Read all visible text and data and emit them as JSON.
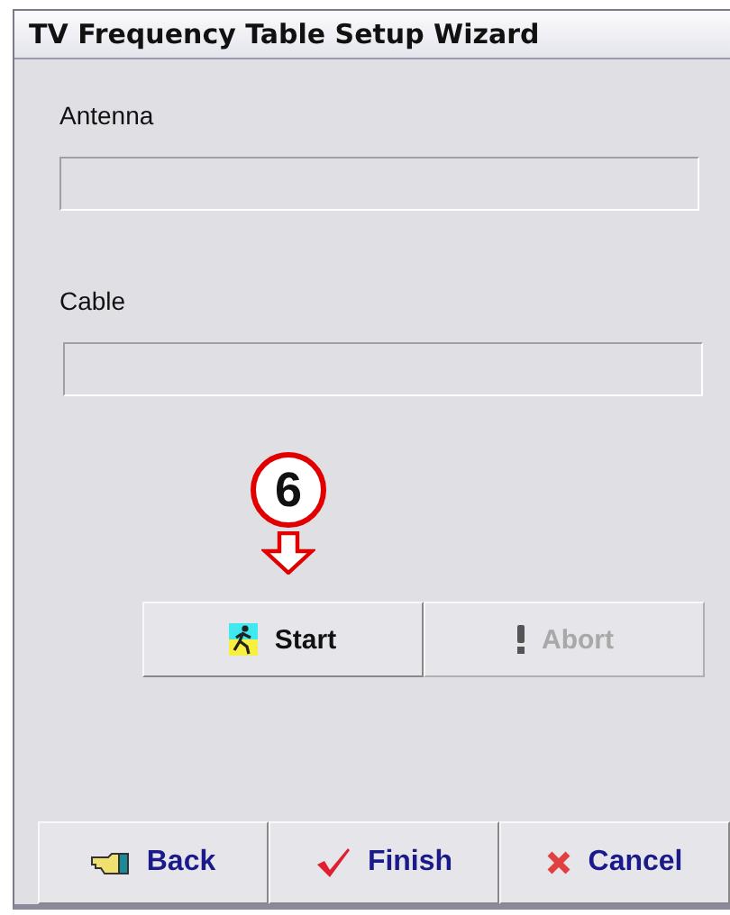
{
  "window": {
    "title": "TV Frequency Table Setup Wizard"
  },
  "fields": [
    {
      "label": "Antenna"
    },
    {
      "label": "Cable"
    }
  ],
  "callout": {
    "number": "6"
  },
  "action_buttons": [
    {
      "label": "Start",
      "kind": "runner",
      "disabled": false
    },
    {
      "label": "Abort",
      "kind": "exclamation",
      "disabled": true
    }
  ],
  "nav_buttons": [
    {
      "label": "Back",
      "kind": "hand"
    },
    {
      "label": "Finish",
      "kind": "check"
    },
    {
      "label": "Cancel",
      "kind": "cross"
    }
  ]
}
